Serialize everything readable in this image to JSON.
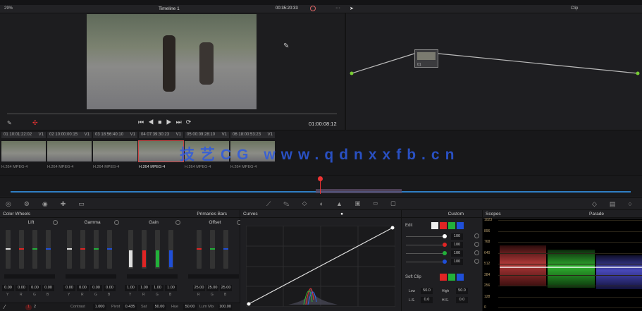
{
  "header": {
    "zoom": "29%",
    "timeline": "Timeline 1",
    "timecode": "00:35:20:33",
    "node_label": "Clip"
  },
  "transport": {
    "timecode": "01:00:08:12"
  },
  "clips": [
    {
      "num": "01",
      "tc": "10:01:22:02",
      "track": "V1",
      "codec": "H.264 MPEG-4"
    },
    {
      "num": "02",
      "tc": "10:00:00:15",
      "track": "V1",
      "codec": "H.264 MPEG-4"
    },
    {
      "num": "03",
      "tc": "18:56:40:10",
      "track": "V1",
      "codec": "H.264 MPEG-4"
    },
    {
      "num": "04",
      "tc": "07:39:30:23",
      "track": "V1",
      "codec": "H.264 MPEG-4",
      "selected": true
    },
    {
      "num": "05",
      "tc": "00:09:28:10",
      "track": "V1",
      "codec": "H.264 MPEG-4"
    },
    {
      "num": "06",
      "tc": "18:00:53:23",
      "track": "V1",
      "codec": "H.264 MPEG-4"
    }
  ],
  "watermark": "技艺CG www.qdnxxfb.cn",
  "node": {
    "label": "01"
  },
  "color_wheels": {
    "title": "Color Wheels",
    "mode": "Primaries Bars",
    "groups": [
      {
        "name": "Lift",
        "values": [
          "0.00",
          "0.00",
          "0.00",
          "0.00"
        ],
        "channels": [
          "Y",
          "R",
          "G",
          "B"
        ]
      },
      {
        "name": "Gamma",
        "values": [
          "0.00",
          "0.00",
          "0.00",
          "0.00"
        ],
        "channels": [
          "Y",
          "R",
          "G",
          "B"
        ]
      },
      {
        "name": "Gain",
        "values": [
          "1.00",
          "1.00",
          "1.00",
          "1.00"
        ],
        "channels": [
          "Y",
          "R",
          "G",
          "B"
        ]
      },
      {
        "name": "Offset",
        "values": [
          "25.00",
          "25.00",
          "25.00"
        ],
        "channels": [
          "R",
          "G",
          "B"
        ]
      }
    ],
    "footer": {
      "page1": "1",
      "page2": "2",
      "contrast_label": "Contrast",
      "contrast": "1.000",
      "pivot_label": "Pivot",
      "pivot": "0.435",
      "sat_label": "Sat",
      "sat": "50.00",
      "hue_label": "Hue",
      "hue": "50.00",
      "lummix_label": "Lum Mix",
      "lummix": "100.00"
    }
  },
  "curves": {
    "title": "Curves"
  },
  "custom": {
    "mode": "Custom",
    "edit_label": "Edit",
    "values": [
      "100",
      "100",
      "100",
      "100"
    ],
    "softclip_label": "Soft Clip",
    "low_label": "Low",
    "low": "50.0",
    "high_label": "High",
    "high": "50.0",
    "ls_label": "L.S.",
    "ls": "0.0",
    "hs_label": "H.S.",
    "hs": "0.0"
  },
  "scopes": {
    "title": "Scopes",
    "mode": "Parade",
    "ticks": [
      "1023",
      "896",
      "768",
      "640",
      "512",
      "384",
      "256",
      "128",
      "0"
    ]
  },
  "colors": {
    "red": "#e02424",
    "green": "#22b03a",
    "blue": "#1f4fd8",
    "accent": "#e03b3b"
  }
}
